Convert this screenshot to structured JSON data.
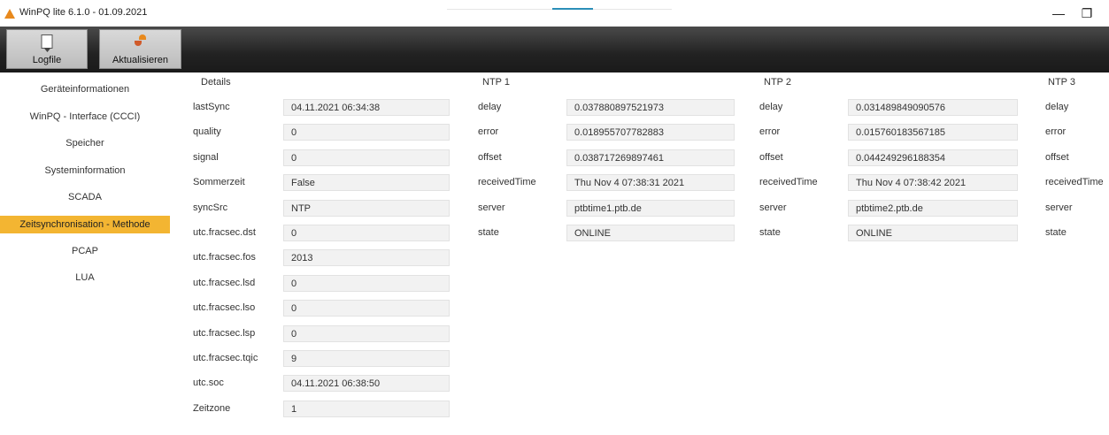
{
  "window": {
    "title": "WinPQ lite  6.1.0 - 01.09.2021",
    "minimize": "—",
    "restore": "❐"
  },
  "toolbar": {
    "logfile_label": "Logfile",
    "refresh_label": "Aktualisieren"
  },
  "sidebar": {
    "items": [
      {
        "label": "Geräteinformationen"
      },
      {
        "label": "WinPQ - Interface (CCCI)"
      },
      {
        "label": "Speicher"
      },
      {
        "label": "Systeminformation"
      },
      {
        "label": "SCADA"
      },
      {
        "label": "Zeitsynchronisation - Methode",
        "active": true
      },
      {
        "label": "PCAP"
      },
      {
        "label": "LUA"
      }
    ],
    "active_color": "#f3b532"
  },
  "details": {
    "header": "Details",
    "rows": [
      {
        "label": "lastSync",
        "value": "04.11.2021 06:34:38"
      },
      {
        "label": "quality",
        "value": "0"
      },
      {
        "label": "signal",
        "value": "0"
      },
      {
        "label": "Sommerzeit",
        "value": "False"
      },
      {
        "label": "syncSrc",
        "value": "NTP"
      },
      {
        "label": "utc.fracsec.dst",
        "value": "0"
      },
      {
        "label": "utc.fracsec.fos",
        "value": "2013"
      },
      {
        "label": "utc.fracsec.lsd",
        "value": "0"
      },
      {
        "label": "utc.fracsec.lso",
        "value": "0"
      },
      {
        "label": "utc.fracsec.lsp",
        "value": "0"
      },
      {
        "label": "utc.fracsec.tqic",
        "value": "9"
      },
      {
        "label": "utc.soc",
        "value": "04.11.2021 06:38:50"
      },
      {
        "label": "Zeitzone",
        "value": "1"
      }
    ]
  },
  "ntp1": {
    "header": "NTP 1",
    "rows": [
      {
        "label": "delay",
        "value": "0.037880897521973"
      },
      {
        "label": "error",
        "value": "0.018955707782883"
      },
      {
        "label": "offset",
        "value": "0.038717269897461"
      },
      {
        "label": "receivedTime",
        "value": "Thu Nov  4 07:38:31 2021"
      },
      {
        "label": "server",
        "value": "ptbtime1.ptb.de"
      },
      {
        "label": "state",
        "value": "ONLINE"
      }
    ]
  },
  "ntp2": {
    "header": "NTP 2",
    "rows": [
      {
        "label": "delay",
        "value": "0.031489849090576"
      },
      {
        "label": "error",
        "value": "0.015760183567185"
      },
      {
        "label": "offset",
        "value": "0.044249296188354"
      },
      {
        "label": "receivedTime",
        "value": "Thu Nov  4 07:38:42 2021"
      },
      {
        "label": "server",
        "value": "ptbtime2.ptb.de"
      },
      {
        "label": "state",
        "value": "ONLINE"
      }
    ]
  },
  "ntp3": {
    "header": "NTP 3",
    "rows": [
      {
        "label": "delay"
      },
      {
        "label": "error"
      },
      {
        "label": "offset"
      },
      {
        "label": "receivedTime"
      },
      {
        "label": "server"
      },
      {
        "label": "state"
      }
    ]
  }
}
